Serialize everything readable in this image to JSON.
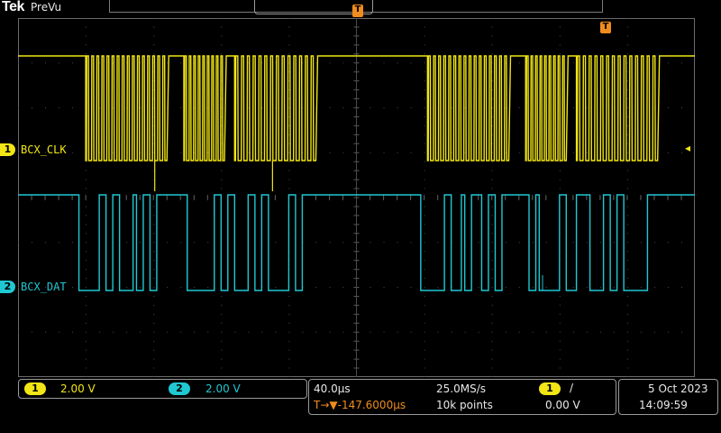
{
  "header": {
    "brand": "Tek",
    "mode": "PreVu"
  },
  "markers": {
    "trigger_position_glyph": "T",
    "trigger_level_glyph": "◂"
  },
  "channels": [
    {
      "number": "1",
      "label": "BCX_CLK",
      "scale": "2.00 V",
      "color": "#f2e616"
    },
    {
      "number": "2",
      "label": "BCX_DAT",
      "scale": "2.00 V",
      "color": "#20c8d2"
    }
  ],
  "horizontal": {
    "time_per_div": "40.0µs",
    "sample_rate": "25.0MS/s",
    "trigger_delay": "T→▼-147.6000µs",
    "record_length": "10k points"
  },
  "trigger": {
    "source": "1",
    "slope_glyph": "/",
    "level": "0.00 V"
  },
  "datetime": {
    "date": "5 Oct  2023",
    "time": "14:09:59"
  },
  "waveform_model": {
    "clk_bursts": [
      [
        10,
        22,
        16
      ],
      [
        24.5,
        30.5,
        9
      ],
      [
        32,
        44,
        14
      ],
      [
        60.5,
        72.5,
        16
      ],
      [
        75,
        81,
        9
      ],
      [
        82.5,
        94.5,
        14
      ]
    ],
    "dat_low_spans": [
      [
        9,
        12
      ],
      [
        13,
        14
      ],
      [
        15,
        17
      ],
      [
        17.5,
        18.5
      ],
      [
        19.5,
        20.5
      ],
      [
        25,
        29
      ],
      [
        30,
        31
      ],
      [
        32,
        34
      ],
      [
        35,
        36
      ],
      [
        37,
        40
      ],
      [
        41,
        42
      ],
      [
        59.5,
        63
      ],
      [
        64,
        65.5
      ],
      [
        66,
        67
      ],
      [
        68.5,
        69.5
      ],
      [
        70.5,
        71.5
      ],
      [
        75.5,
        76.5
      ],
      [
        77,
        80
      ],
      [
        81,
        82.5
      ],
      [
        84.5,
        86.5
      ],
      [
        87.5,
        88.5
      ],
      [
        89.5,
        93
      ]
    ]
  }
}
